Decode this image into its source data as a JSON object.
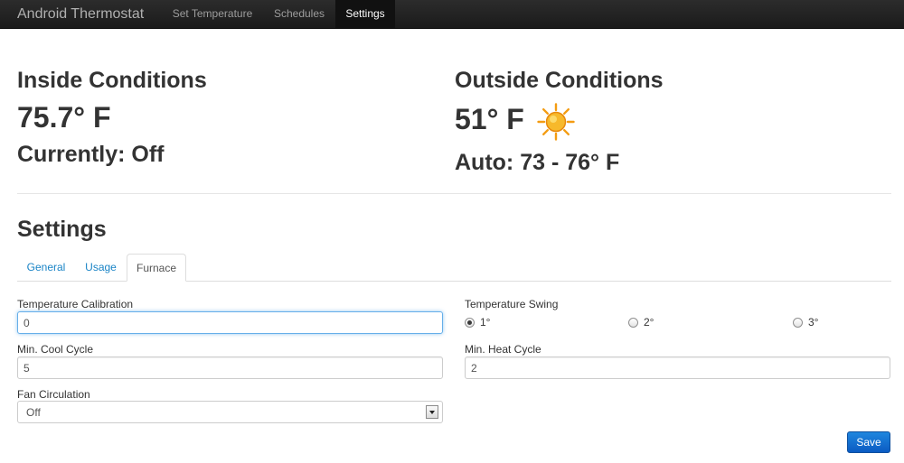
{
  "navbar": {
    "brand": "Android Thermostat",
    "items": [
      {
        "label": "Set Temperature",
        "active": false
      },
      {
        "label": "Schedules",
        "active": false
      },
      {
        "label": "Settings",
        "active": true
      }
    ]
  },
  "inside": {
    "title": "Inside Conditions",
    "temperature": "75.7° F",
    "status": "Currently: Off"
  },
  "outside": {
    "title": "Outside Conditions",
    "temperature": "51° F",
    "weather_icon": "sun-icon",
    "auto_range": "Auto: 73 - 76° F"
  },
  "settings": {
    "title": "Settings",
    "tabs": [
      {
        "label": "General",
        "active": false
      },
      {
        "label": "Usage",
        "active": false
      },
      {
        "label": "Furnace",
        "active": true
      }
    ],
    "fields": {
      "temperature_calibration": {
        "label": "Temperature Calibration",
        "value": "0"
      },
      "min_cool_cycle": {
        "label": "Min. Cool Cycle",
        "value": "5"
      },
      "fan_circulation": {
        "label": "Fan Circulation",
        "selected": "Off"
      },
      "temperature_swing": {
        "label": "Temperature Swing",
        "options": [
          {
            "label": "1°",
            "checked": true
          },
          {
            "label": "2°",
            "checked": false
          },
          {
            "label": "3°",
            "checked": false
          }
        ]
      },
      "min_heat_cycle": {
        "label": "Min. Heat Cycle",
        "value": "2"
      }
    },
    "save_label": "Save"
  },
  "colors": {
    "navbar": "#1b1b1b",
    "link": "#1a84c6",
    "primary_button": "#0b5bc3",
    "focus": "#66afe9"
  }
}
